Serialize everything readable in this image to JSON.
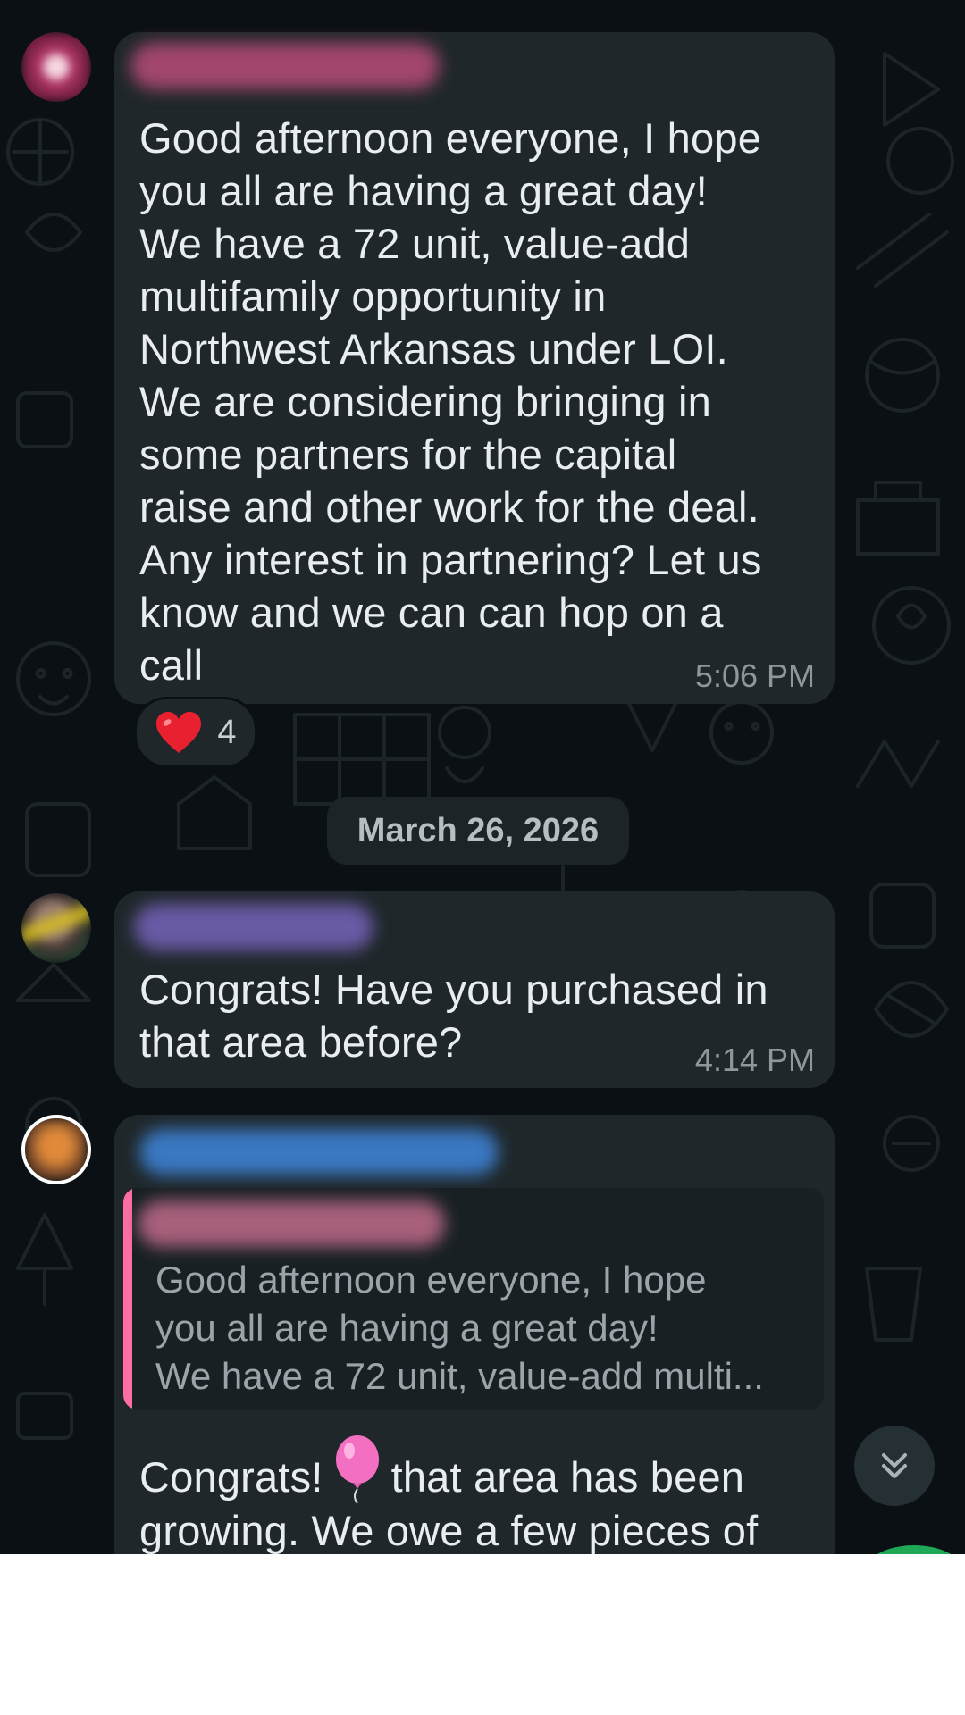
{
  "messages": [
    {
      "text": "Good afternoon everyone, I hope\nyou all are having a great day!\nWe have a 72 unit, value-add\nmultifamily opportunity in\nNorthwest Arkansas under LOI.\nWe are considering bringing in\nsome partners for the capital\nraise and other work for the deal.\nAny interest in partnering? Let us\nknow and we can can hop on a\ncall",
      "time": "5:06 PM",
      "reaction": {
        "emoji": "heart",
        "count": "4"
      }
    },
    {
      "text": "Congrats! Have you purchased in\nthat area before?",
      "time": "4:14 PM"
    },
    {
      "quote_text": "Good afternoon everyone, I hope\nyou all are having a great day!\nWe have a 72 unit, value-add multi...",
      "text_before_emoji": "Congrats!",
      "emoji": "balloon",
      "text_after_emoji": "that area has been",
      "text_line2": "growing. We owe a few pieces of"
    }
  ],
  "date_separator": "March 26, 2026",
  "icons": {
    "scroll_down": "double-chevron-down-icon",
    "reaction": "heart-icon"
  },
  "colors": {
    "chat_background": "#0b1014",
    "bubble": "#1f272a",
    "text": "#e9edef",
    "timestamp": "#8e989c",
    "quote_bar": "#ff6ea3",
    "heart": "#e8202f"
  }
}
